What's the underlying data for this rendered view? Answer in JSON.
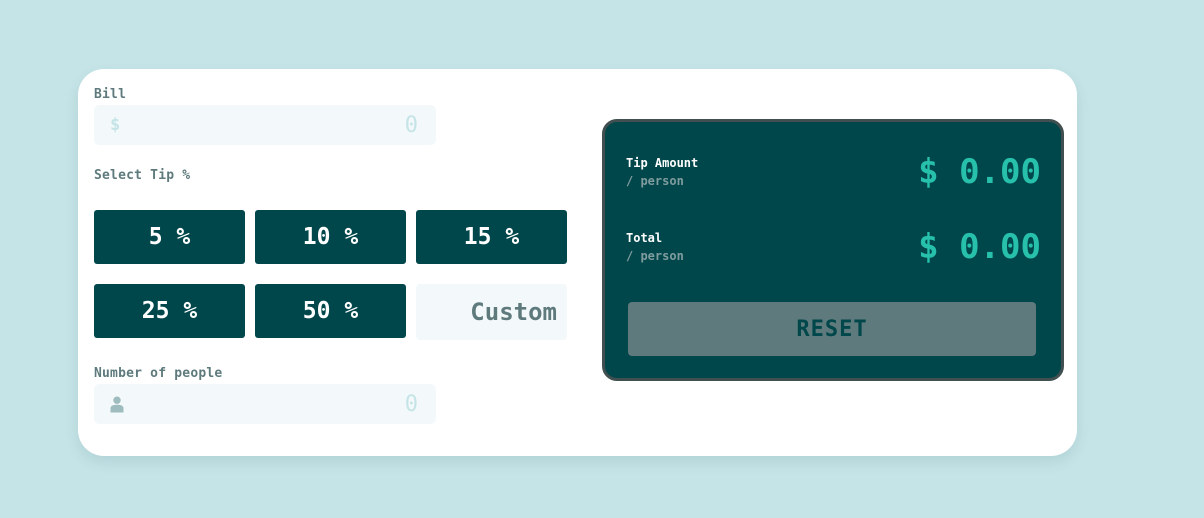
{
  "colors": {
    "page_background": "#c5e4e7",
    "card_background": "#ffffff",
    "primary_dark": "#00474b",
    "accent": "#26c0ab",
    "label_grey": "#5e7a7d",
    "input_background": "#f3f9fa",
    "result_border": "#414f50",
    "reset_disabled": "#5e7a7d"
  },
  "bill": {
    "label": "Bill",
    "icon": "dollar-icon",
    "icon_glyph": "$",
    "value": "",
    "placeholder": "0"
  },
  "tip": {
    "label": "Select Tip %",
    "options": [
      {
        "label": "5 %"
      },
      {
        "label": "10 %"
      },
      {
        "label": "15 %"
      },
      {
        "label": "25 %"
      },
      {
        "label": "50 %"
      }
    ],
    "custom_placeholder": "Custom"
  },
  "people": {
    "label": "Number of people",
    "icon": "person-icon",
    "value": "",
    "placeholder": "0"
  },
  "results": {
    "tip_amount": {
      "title": "Tip Amount",
      "subtitle": "/ person",
      "value": "$ 0.00"
    },
    "total": {
      "title": "Total",
      "subtitle": "/ person",
      "value": "$ 0.00"
    },
    "reset_label": "RESET"
  }
}
